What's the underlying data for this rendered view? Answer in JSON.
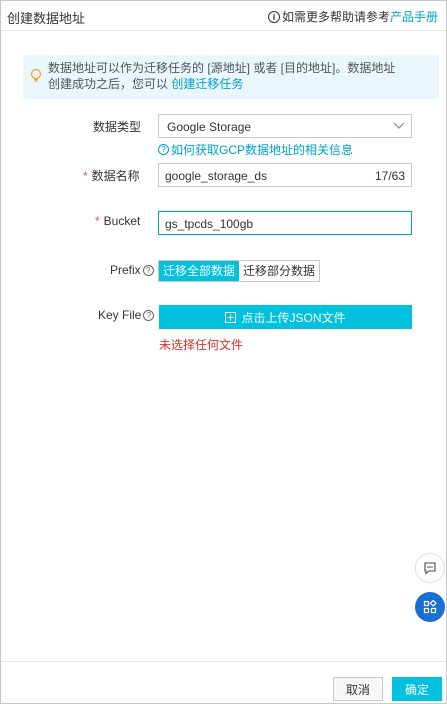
{
  "header": {
    "title": "创建数据地址",
    "help_prefix": "如需更多帮助请参考",
    "help_link": "产品手册"
  },
  "tip": {
    "line1": "数据地址可以作为迁移任务的 [源地址] 或者 [目的地址]。数据地址",
    "line2_prefix": "创建成功之后，您可以",
    "line2_link": "创建迁移任务"
  },
  "form": {
    "type_label": "数据类型",
    "type_value": "Google Storage",
    "gcp_help_link": "如何获取GCP数据地址的相关信息",
    "name_label": "数据名称",
    "name_value": "google_storage_ds",
    "name_counter": "17/63",
    "bucket_label": "Bucket",
    "bucket_value": "gs_tpcds_100gb",
    "prefix_label": "Prefix",
    "prefix_options": [
      "迁移全部数据",
      "迁移部分数据"
    ],
    "keyfile_label": "Key File",
    "upload_label": "点击上传JSON文件",
    "no_file_text": "未选择任何文件"
  },
  "footer": {
    "cancel_label": "取消",
    "confirm_label": "确定"
  },
  "colors": {
    "accent": "#00c1de",
    "link": "#00a2ca",
    "error": "#d93026",
    "float_blue": "#1a6fd4"
  },
  "icons": [
    "info-icon",
    "lightbulb-icon",
    "chevron-down-icon",
    "question-icon",
    "upload-icon",
    "chat-icon",
    "apps-icon"
  ]
}
